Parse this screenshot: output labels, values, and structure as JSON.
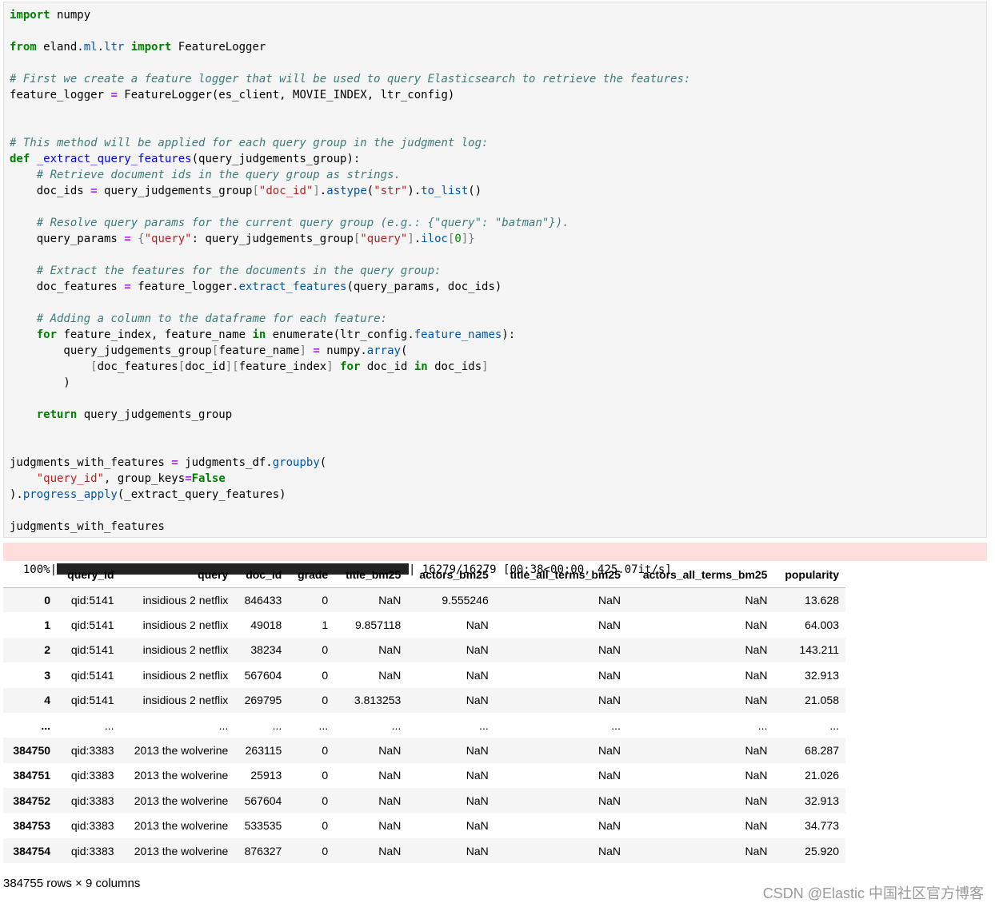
{
  "code_lines": [
    "import numpy",
    "",
    "from eland.ml.ltr import FeatureLogger",
    "",
    "# First we create a feature logger that will be used to query Elasticsearch to retrieve the features:",
    "feature_logger = FeatureLogger(es_client, MOVIE_INDEX, ltr_config)",
    "",
    "",
    "# This method will be applied for each query group in the judgment log:",
    "def _extract_query_features(query_judgements_group):",
    "    # Retrieve document ids in the query group as strings.",
    "    doc_ids = query_judgements_group[\"doc_id\"].astype(\"str\").to_list()",
    "",
    "    # Resolve query params for the current query group (e.g.: {\"query\": \"batman\"}).",
    "    query_params = {\"query\": query_judgements_group[\"query\"].iloc[0]}",
    "",
    "    # Extract the features for the documents in the query group:",
    "    doc_features = feature_logger.extract_features(query_params, doc_ids)",
    "",
    "    # Adding a column to the dataframe for each feature:",
    "    for feature_index, feature_name in enumerate(ltr_config.feature_names):",
    "        query_judgements_group[feature_name] = numpy.array(",
    "            [doc_features[doc_id][feature_index] for doc_id in doc_ids]",
    "        )",
    "",
    "    return query_judgements_group",
    "",
    "",
    "judgments_with_features = judgments_df.groupby(",
    "    \"query_id\", group_keys=False",
    ").progress_apply(_extract_query_features)",
    "",
    "judgments_with_features"
  ],
  "progress": {
    "percent": "100%|",
    "fraction": 1.0,
    "tail": "| 16279/16279 [00:38<00:00, 425.07it/s]"
  },
  "table": {
    "columns": [
      "",
      "query_id",
      "query",
      "doc_id",
      "grade",
      "title_bm25",
      "actors_bm25",
      "title_all_terms_bm25",
      "actors_all_terms_bm25",
      "popularity"
    ],
    "rows": [
      [
        "0",
        "qid:5141",
        "insidious 2 netflix",
        "846433",
        "0",
        "NaN",
        "9.555246",
        "NaN",
        "NaN",
        "13.628"
      ],
      [
        "1",
        "qid:5141",
        "insidious 2 netflix",
        "49018",
        "1",
        "9.857118",
        "NaN",
        "NaN",
        "NaN",
        "64.003"
      ],
      [
        "2",
        "qid:5141",
        "insidious 2 netflix",
        "38234",
        "0",
        "NaN",
        "NaN",
        "NaN",
        "NaN",
        "143.211"
      ],
      [
        "3",
        "qid:5141",
        "insidious 2 netflix",
        "567604",
        "0",
        "NaN",
        "NaN",
        "NaN",
        "NaN",
        "32.913"
      ],
      [
        "4",
        "qid:5141",
        "insidious 2 netflix",
        "269795",
        "0",
        "3.813253",
        "NaN",
        "NaN",
        "NaN",
        "21.058"
      ],
      [
        "...",
        "...",
        "...",
        "...",
        "...",
        "...",
        "...",
        "...",
        "...",
        "..."
      ],
      [
        "384750",
        "qid:3383",
        "2013 the wolverine",
        "263115",
        "0",
        "NaN",
        "NaN",
        "NaN",
        "NaN",
        "68.287"
      ],
      [
        "384751",
        "qid:3383",
        "2013 the wolverine",
        "25913",
        "0",
        "NaN",
        "NaN",
        "NaN",
        "NaN",
        "21.026"
      ],
      [
        "384752",
        "qid:3383",
        "2013 the wolverine",
        "567604",
        "0",
        "NaN",
        "NaN",
        "NaN",
        "NaN",
        "32.913"
      ],
      [
        "384753",
        "qid:3383",
        "2013 the wolverine",
        "533535",
        "0",
        "NaN",
        "NaN",
        "NaN",
        "NaN",
        "34.773"
      ],
      [
        "384754",
        "qid:3383",
        "2013 the wolverine",
        "876327",
        "0",
        "NaN",
        "NaN",
        "NaN",
        "NaN",
        "25.920"
      ]
    ]
  },
  "footer": "384755 rows × 9 columns",
  "watermark": "CSDN @Elastic 中国社区官方博客",
  "colors": {
    "keyword": "#008000",
    "comment": "#3d7b7b",
    "string": "#ba2121",
    "function": "#0000ff",
    "stderr_bg": "#ffdddd"
  }
}
